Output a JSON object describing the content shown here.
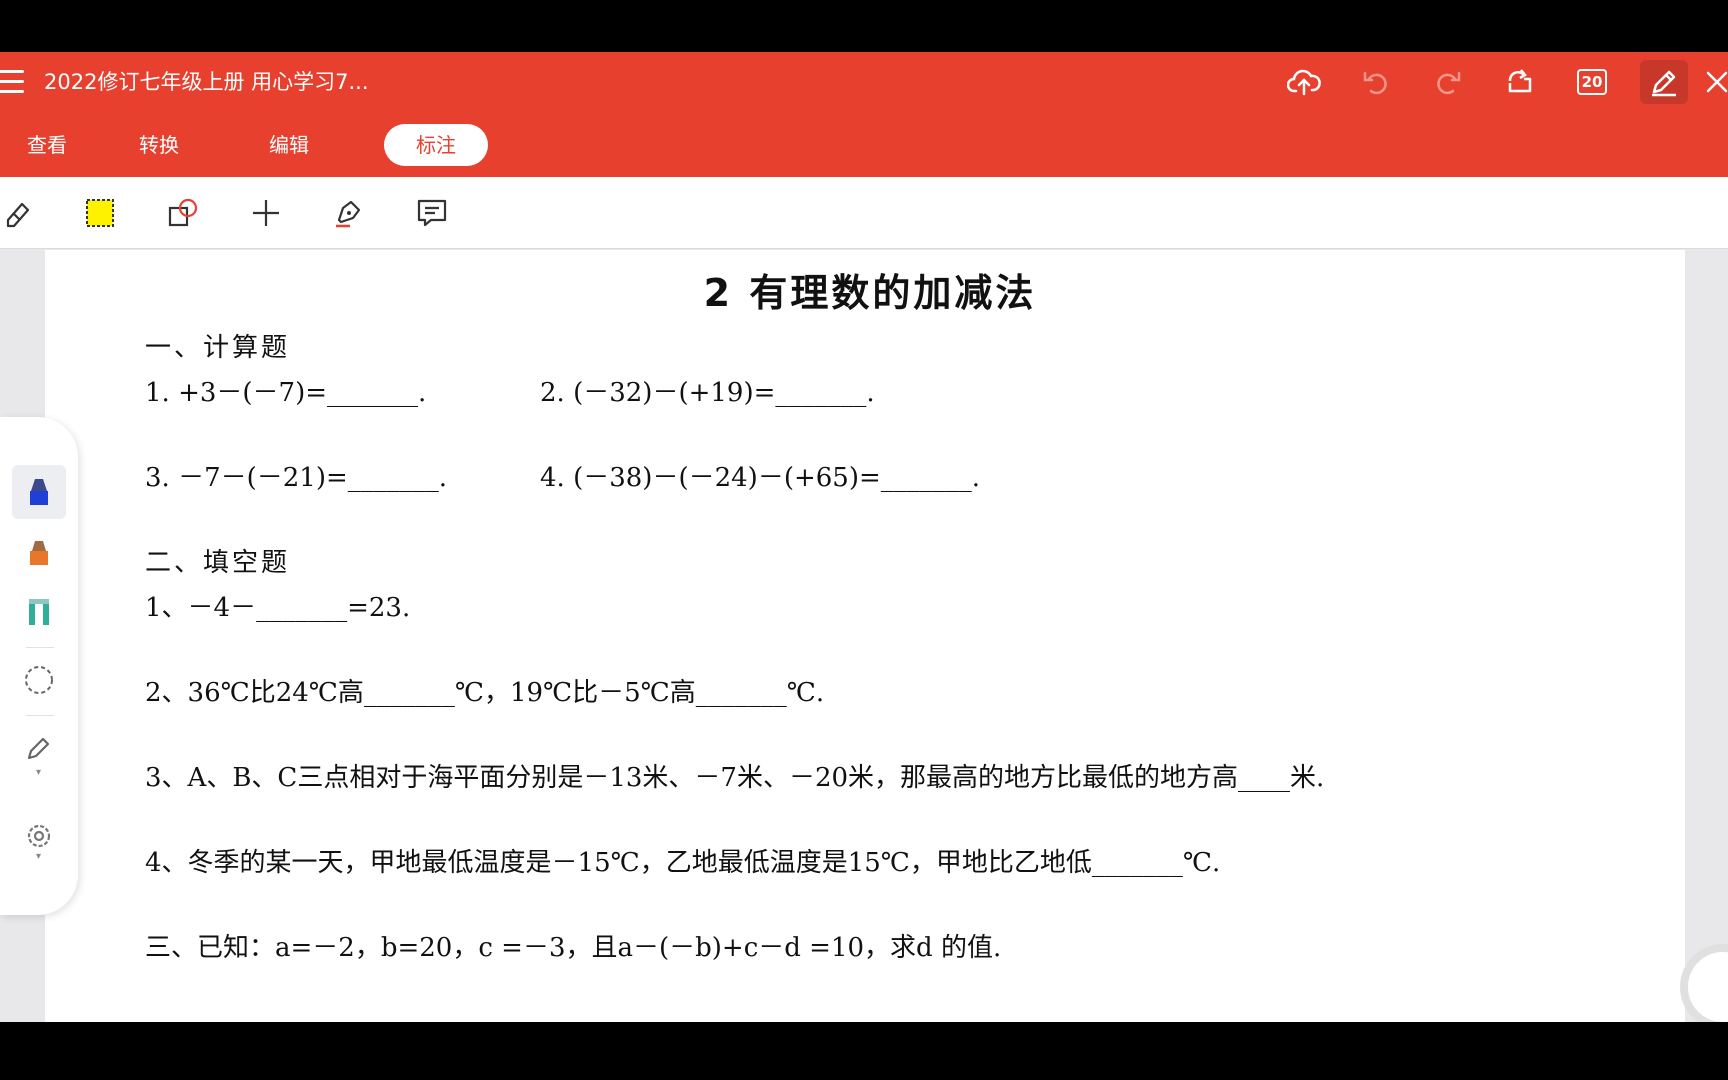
{
  "app": {
    "document_title": "2022修订七年级上册 用心学习7...",
    "page_count": "20",
    "colors": {
      "brand": "#e8402f",
      "toolbar_bg": "#ffffff",
      "page_bg": "#ffffff",
      "highlight": "#fff200"
    }
  },
  "title_actions": [
    "cloud-upload-icon",
    "undo-icon",
    "redo-icon",
    "rotate-icon",
    "page-count-icon",
    "edit-pen-icon",
    "close-icon"
  ],
  "tabs": [
    {
      "label": "查看"
    },
    {
      "label": "转换"
    },
    {
      "label": "编辑"
    },
    {
      "label": "标注",
      "active": true
    }
  ],
  "annotation_tools": [
    "eraser-icon",
    "highlight-rect-icon",
    "shape-icon",
    "plus-icon",
    "pen-icon",
    "comment-icon"
  ],
  "pen_panel": [
    "blue-marker-icon",
    "orange-marker-icon",
    "teal-highlighter-icon",
    "lasso-icon",
    "pencil-icon",
    "settings-icon"
  ],
  "document": {
    "heading": "2 有理数的加减法",
    "section1": "一、计算题",
    "q1": "1. +3－(－7)=_______.",
    "q2": "2. (－32)－(+19)=_______.",
    "q3": "3. －7－(－21)=_______.",
    "q4": "4. (－38)－(－24)－(+65)=_______.",
    "section2": "二、填空题",
    "f1": "1、－4－_______=23.",
    "f2": "2、36℃比24℃高_______℃，19℃比－5℃高_______℃.",
    "f3": "3、A、B、C三点相对于海平面分别是－13米、－7米、－20米，那最高的地方比最低的地方高____米.",
    "f4": "4、冬季的某一天，甲地最低温度是－15℃，乙地最低温度是15℃，甲地比乙地低_______℃.",
    "section3": "三、已知：a=－2，b=20，c =－3，且a－(－b)+c－d =10，求d 的值."
  }
}
